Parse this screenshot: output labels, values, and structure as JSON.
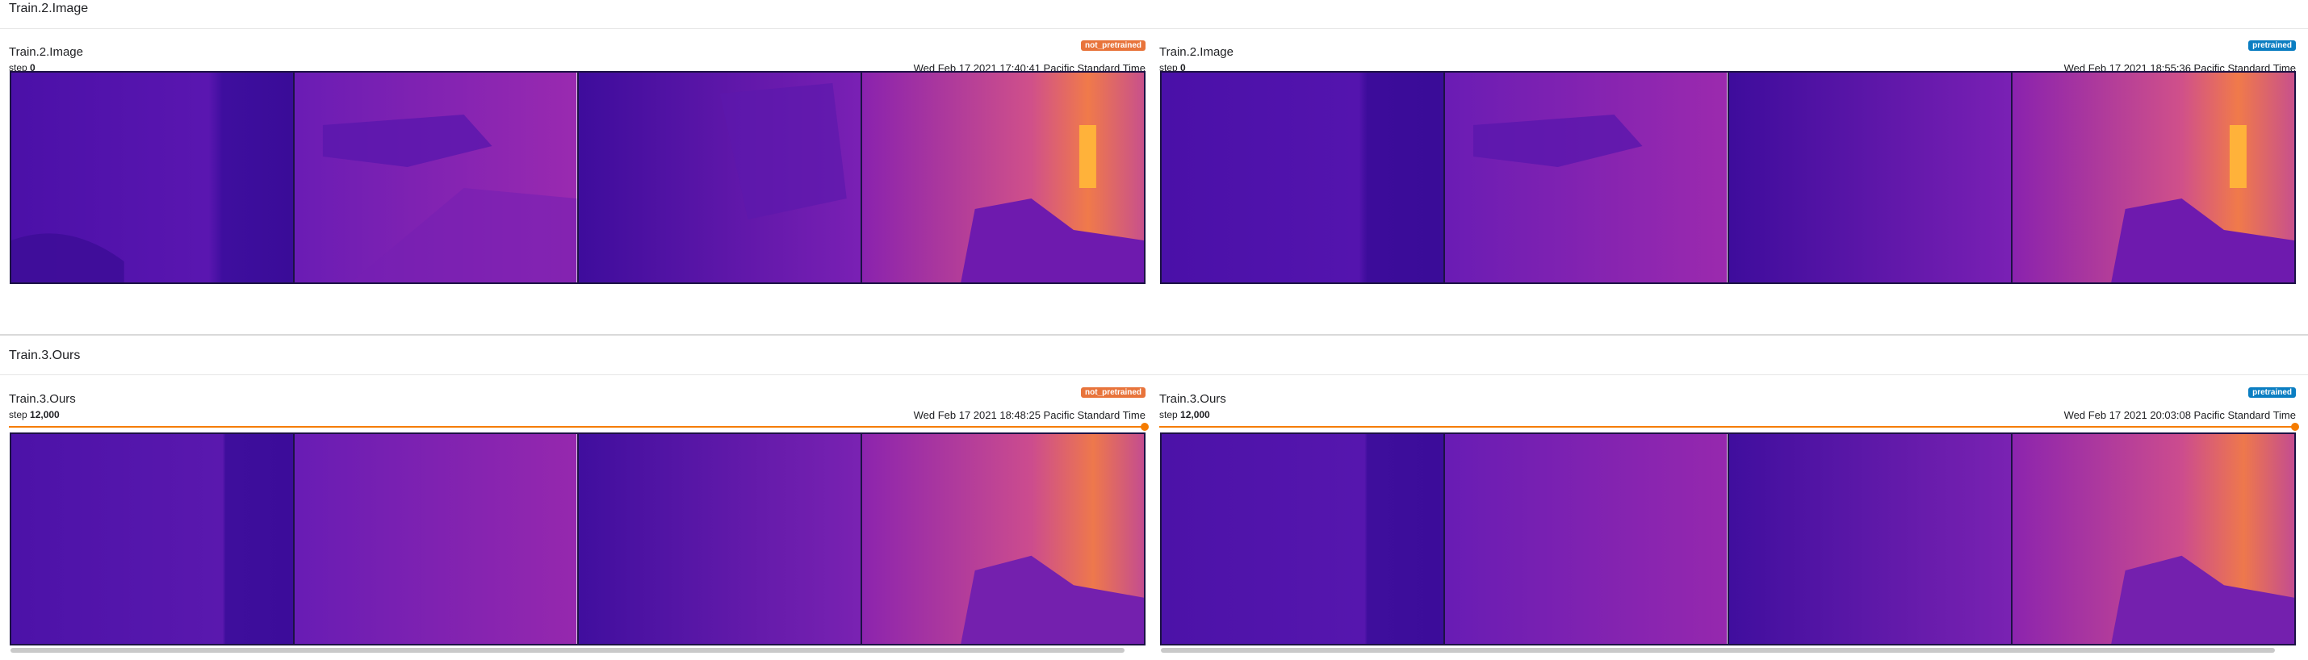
{
  "sections": [
    {
      "title": "Train.2.Image",
      "cards": [
        {
          "title": "Train.2.Image",
          "badge": "not_pretrained",
          "badge_color": "#e8743b",
          "step_label": "step",
          "step_value": "0",
          "timestamp": "Wed Feb 17 2021 17:40:41 Pacific Standard Time",
          "has_slider": false
        },
        {
          "title": "Train.2.Image",
          "badge": "pretrained",
          "badge_color": "#0b7ec2",
          "step_label": "step",
          "step_value": "0",
          "timestamp": "Wed Feb 17 2021 18:55:36 Pacific Standard Time",
          "has_slider": false
        }
      ]
    },
    {
      "title": "Train.3.Ours",
      "cards": [
        {
          "title": "Train.3.Ours",
          "badge": "not_pretrained",
          "badge_color": "#e8743b",
          "step_label": "step",
          "step_value": "12,000",
          "timestamp": "Wed Feb 17 2021 18:48:25 Pacific Standard Time",
          "has_slider": true,
          "slider_position": 1.0
        },
        {
          "title": "Train.3.Ours",
          "badge": "pretrained",
          "badge_color": "#0b7ec2",
          "step_label": "step",
          "step_value": "12,000",
          "timestamp": "Wed Feb 17 2021 20:03:08 Pacific Standard Time",
          "has_slider": true,
          "slider_position": 1.0
        }
      ]
    }
  ],
  "colors": {
    "accent": "#f57c00",
    "depth_dark": "#3a0a9a",
    "depth_mid": "#8a1fb0",
    "depth_warm": "#f07a4a",
    "depth_hot": "#ffb23a"
  },
  "images": {
    "description_icon": "depth-map-image"
  }
}
